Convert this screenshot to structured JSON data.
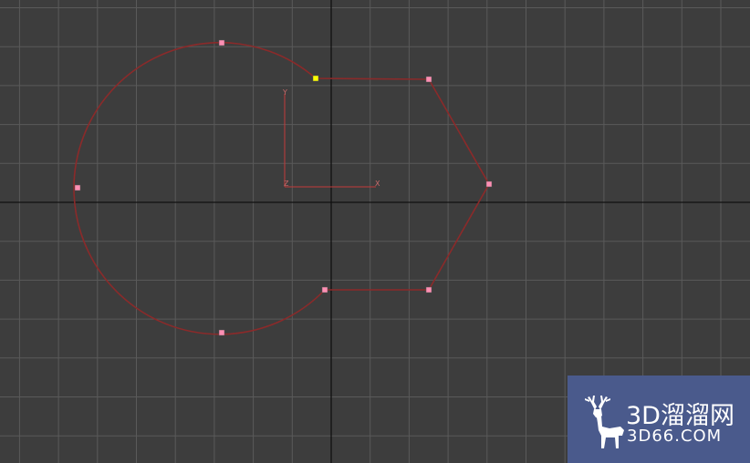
{
  "viewport": {
    "background_color": "#3d3d3d",
    "grid_color": "#5a5a5a",
    "axis_color": "#111111",
    "spline_color": "#8b2a2a",
    "vertex_color": "#ff8fb4",
    "first_vertex_color": "#ffff00",
    "gizmo_color": "#c23a3a"
  },
  "gizmo": {
    "y_label": "Y",
    "x_label": "X",
    "z_label": "Z"
  },
  "watermark": {
    "title": "3D溜溜网",
    "url": "3D66.COM",
    "icon": "deer-icon",
    "background_color": "#4a5a8c"
  }
}
